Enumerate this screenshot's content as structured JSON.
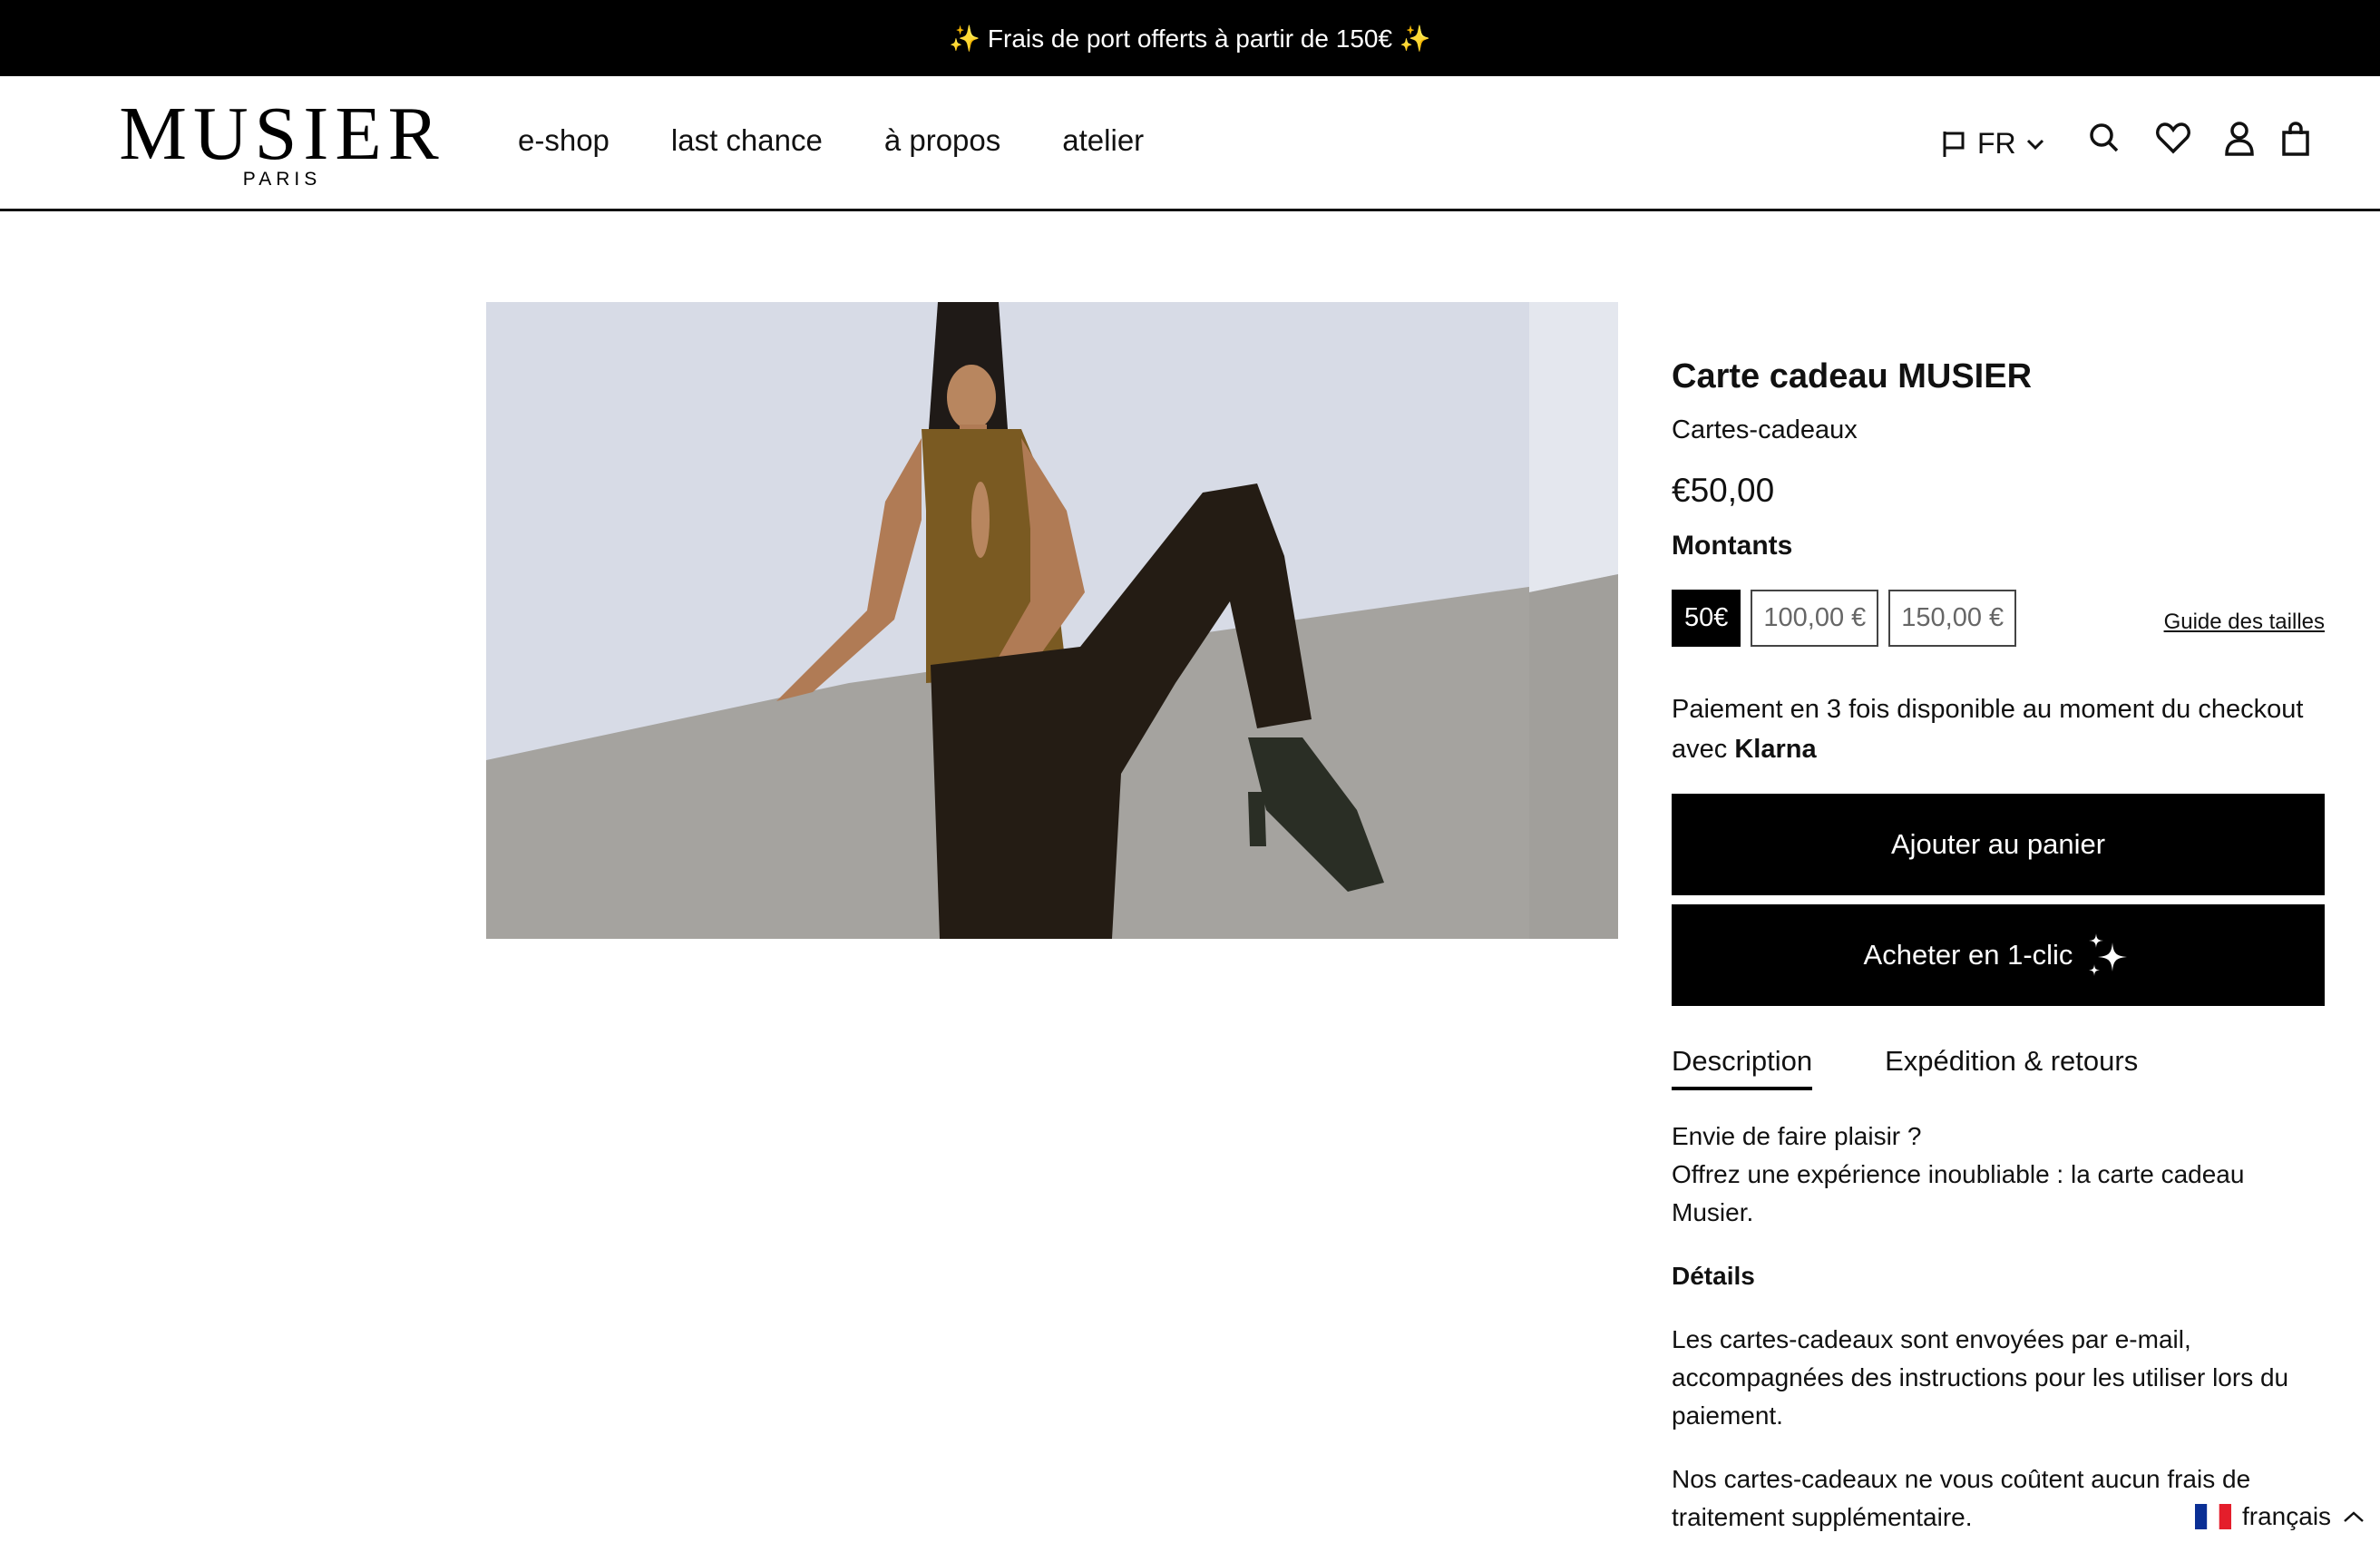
{
  "announcement": "✨ Frais de port offerts à partir de 150€ ✨",
  "brand": {
    "name": "MUSIER",
    "sub": "PARIS"
  },
  "nav": [
    "e-shop",
    "last chance",
    "à propos",
    "atelier"
  ],
  "header_tools": {
    "language": "FR"
  },
  "product": {
    "title": "Carte cadeau MUSIER",
    "vendor": "Cartes-cadeaux",
    "price": "€50,00",
    "option_label": "Montants",
    "amounts": [
      "50€",
      "100,00 €",
      "150,00 €"
    ],
    "selected_amount": "50€",
    "size_guide": "Guide des tailles",
    "klarna_text": "Paiement en 3 fois disponible au moment du checkout avec",
    "klarna_brand": "Klarna",
    "add_to_cart": "Ajouter au panier",
    "buy_one_click": "Acheter en 1-clic",
    "tabs": [
      "Description",
      "Expédition & retours"
    ],
    "active_tab": "Description",
    "description": {
      "line1": "Envie de faire plaisir ?",
      "line2": "Offrez une expérience inoubliable : la carte cadeau Musier.",
      "details_heading": "Détails",
      "para1": "Les cartes-cadeaux sont envoyées par e-mail, accompagnées des instructions pour les utiliser lors du paiement.",
      "para2": "Nos cartes-cadeaux ne vous coûtent aucun frais de traitement supplémentaire."
    }
  },
  "language_switcher": {
    "label": "français"
  },
  "colors": {
    "accent": "#000000",
    "background": "#ffffff",
    "text": "#111111"
  }
}
